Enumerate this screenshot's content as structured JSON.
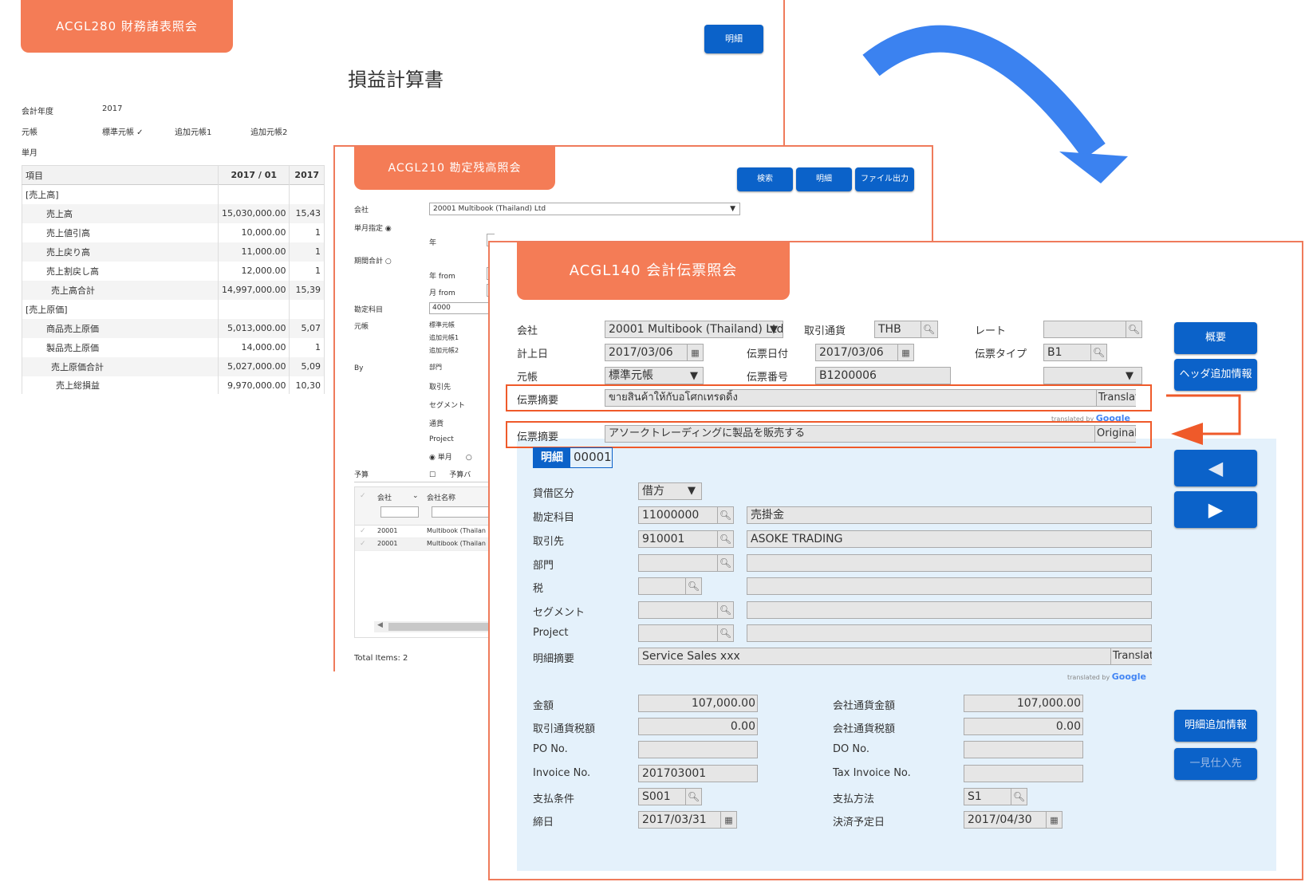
{
  "win1": {
    "title": "ACGL280 財務諸表照会",
    "detail_btn": "明細",
    "heading": "損益計算書",
    "fiscal_year_label": "会計年度",
    "fiscal_year": "2017",
    "ledger_label": "元帳",
    "ledger_opts": [
      "標準元帳 ✓",
      "追加元帳1",
      "追加元帳2"
    ],
    "month_label": "単月",
    "table_headers": [
      "項目",
      "2017 / 01",
      "2017"
    ],
    "rows": [
      {
        "label": "[売上高]",
        "v1": "",
        "v2": ""
      },
      {
        "label": "売上高",
        "v1": "15,030,000.00",
        "v2": "15,43"
      },
      {
        "label": "売上値引高",
        "v1": "10,000.00",
        "v2": "1"
      },
      {
        "label": "売上戻り高",
        "v1": "11,000.00",
        "v2": "1"
      },
      {
        "label": "売上割戻し高",
        "v1": "12,000.00",
        "v2": "1"
      },
      {
        "label": "売上高合計",
        "v1": "14,997,000.00",
        "v2": "15,39"
      },
      {
        "label": "[売上原価]",
        "v1": "",
        "v2": ""
      },
      {
        "label": "商品売上原価",
        "v1": "5,013,000.00",
        "v2": "5,07"
      },
      {
        "label": "製品売上原価",
        "v1": "14,000.00",
        "v2": "1"
      },
      {
        "label": "売上原価合計",
        "v1": "5,027,000.00",
        "v2": "5,09"
      },
      {
        "label": "売上総損益",
        "v1": "9,970,000.00",
        "v2": "10,30"
      }
    ]
  },
  "win2": {
    "title": "ACGL210 勘定残高照会",
    "buttons": [
      "検索",
      "明細",
      "ファイル出力"
    ],
    "company_label": "会社",
    "company_value": "20001 Multibook (Thailand) Ltd",
    "single_month_label": "単月指定",
    "year_label": "年",
    "period_label": "期間合計",
    "year_from_label": "年 from",
    "month_from_label": "月 from",
    "account_label": "勘定科目",
    "account_value": "4000",
    "ledger_label": "元帳",
    "ledger_opts": [
      "標準元帳",
      "追加元帳1",
      "追加元帳2"
    ],
    "by_label": "By",
    "by_opts": [
      "部門",
      "取引先",
      "セグメント",
      "通貨",
      "Project"
    ],
    "radio_single": "単月",
    "budget_label": "予算",
    "budget_opt": "予算バ",
    "grid_headers": [
      "会社",
      "会社名称"
    ],
    "grid_rows": [
      {
        "code": "20001",
        "name": "Multibook (Thailan"
      },
      {
        "code": "20001",
        "name": "Multibook (Thailan"
      }
    ],
    "total_items": "Total Items: 2"
  },
  "win3": {
    "title": "ACGL140 会計伝票照会",
    "company_label": "会社",
    "company_value": "20001 Multibook (Thailand) Ltd",
    "currency_label": "取引通貨",
    "currency_value": "THB",
    "rate_label": "レート",
    "post_date_label": "計上日",
    "post_date": "2017/03/06",
    "slip_date_label": "伝票日付",
    "slip_date": "2017/03/06",
    "slip_type_label": "伝票タイプ",
    "slip_type": "B1",
    "ledger_label": "元帳",
    "ledger_value": "標準元帳",
    "slip_no_label": "伝票番号",
    "slip_no": "B1200006",
    "summary_label": "伝票摘要",
    "summary_thai": "ขายสินค้าให้กับอโศกเทรดดิ้ง",
    "translate_btn": "Translat",
    "translated_by": "translated by",
    "google": "Google",
    "summary_jp": "アソークトレーディングに製品を販売する",
    "original_btn": "Original",
    "side_btns": [
      "概要",
      "ヘッダ追加情報"
    ],
    "detail_tab": "明細",
    "detail_no": "00001",
    "debit_credit_label": "貸借区分",
    "debit_credit": "借方",
    "account_label": "勘定科目",
    "account_code": "11000000",
    "account_name": "売掛金",
    "partner_label": "取引先",
    "partner_code": "910001",
    "partner_name": "ASOKE TRADING",
    "dept_label": "部門",
    "tax_label": "税",
    "segment_label": "セグメント",
    "project_label": "Project",
    "line_summary_label": "明細摘要",
    "line_summary": "Service Sales xxx",
    "amount_label": "金額",
    "amount": "107,000.00",
    "co_amount_label": "会社通貨金額",
    "co_amount": "107,000.00",
    "tax_amount_label": "取引通貨税額",
    "tax_amount": "0.00",
    "co_tax_label": "会社通貨税額",
    "co_tax": "0.00",
    "po_label": "PO No.",
    "do_label": "DO No.",
    "invoice_label": "Invoice No.",
    "invoice_value": "201703001",
    "tax_invoice_label": "Tax Invoice No.",
    "pay_terms_label": "支払条件",
    "pay_terms": "S001",
    "pay_method_label": "支払方法",
    "pay_method": "S1",
    "close_date_label": "締日",
    "close_date": "2017/03/31",
    "settle_date_label": "決済予定日",
    "settle_date": "2017/04/30",
    "line_btns": [
      "明細追加情報",
      "一見仕入先"
    ]
  },
  "colors": {
    "accent": "#f47c56",
    "button": "#0b62c9",
    "arrow": "#3b82f0",
    "detail_bg": "#e4f1fb"
  }
}
